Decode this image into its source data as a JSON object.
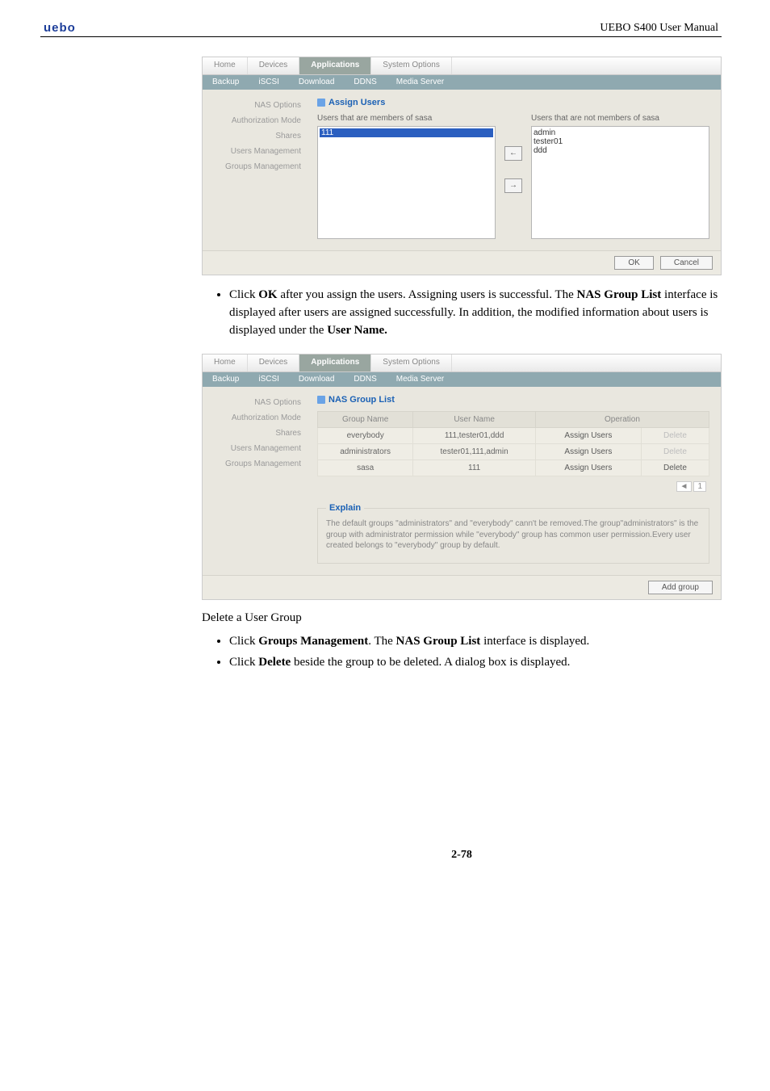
{
  "header": {
    "logo": "uebo",
    "manual": "UEBO S400 User Manual"
  },
  "page_no": "2-78",
  "sub_heading": "Delete a User Group",
  "bullets_after_shot1": [
    {
      "pre": "Click ",
      "b1": "OK",
      "mid1": " after you assign the users. Assigning users is successful. The ",
      "b2": "NAS Group List",
      "mid2": " interface is displayed after users are assigned successfully. In addition, the modified information about users is displayed under the ",
      "b3": "User Name."
    }
  ],
  "bullets_delete": [
    {
      "pre": "Click ",
      "b1": "Groups Management",
      "mid1": ". The ",
      "b2": "NAS Group List",
      "mid2": " interface is displayed."
    },
    {
      "pre": "Click ",
      "b1": "Delete",
      "mid1": " beside the group to be deleted. A dialog box is displayed."
    }
  ],
  "tabs": {
    "home": "Home",
    "devices": "Devices",
    "applications": "Applications",
    "system": "System Options"
  },
  "subtabs": {
    "backup": "Backup",
    "iscsi": "iSCSI",
    "download": "Download",
    "ddns": "DDNS",
    "media": "Media Server"
  },
  "sidebar": {
    "nas_options": "NAS Options",
    "auth_mode": "Authorization Mode",
    "shares": "Shares",
    "users_mgmt": "Users Management",
    "groups_mgmt": "Groups Management"
  },
  "assign": {
    "title": "Assign Users",
    "members_label": "Users that are members of sasa",
    "nonmembers_label": "Users that are not members of sasa",
    "members": [
      "111"
    ],
    "nonmembers": [
      "admin",
      "tester01",
      "ddd"
    ],
    "left_arrow": "←",
    "right_arrow": "→",
    "ok": "OK",
    "cancel": "Cancel"
  },
  "grouplist": {
    "title": "NAS Group List",
    "col_group": "Group Name",
    "col_user": "User Name",
    "col_op": "Operation",
    "rows": [
      {
        "group": "everybody",
        "users": "111,tester01,ddd",
        "assign": "Assign Users",
        "del": "Delete",
        "del_disabled": true
      },
      {
        "group": "administrators",
        "users": "tester01,111,admin",
        "assign": "Assign Users",
        "del": "Delete",
        "del_disabled": true
      },
      {
        "group": "sasa",
        "users": "111",
        "assign": "Assign Users",
        "del": "Delete",
        "del_disabled": false
      }
    ],
    "pager_prev": "◄",
    "pager_page": "1",
    "explain_title": "Explain",
    "explain_text": "The default groups \"administrators\" and \"everybody\" cann't be removed.The group\"administrators\" is the group with administrator permission while \"everybody\" group has common user permission.Every user created belongs to \"everybody\" group by default.",
    "add_group": "Add group"
  }
}
